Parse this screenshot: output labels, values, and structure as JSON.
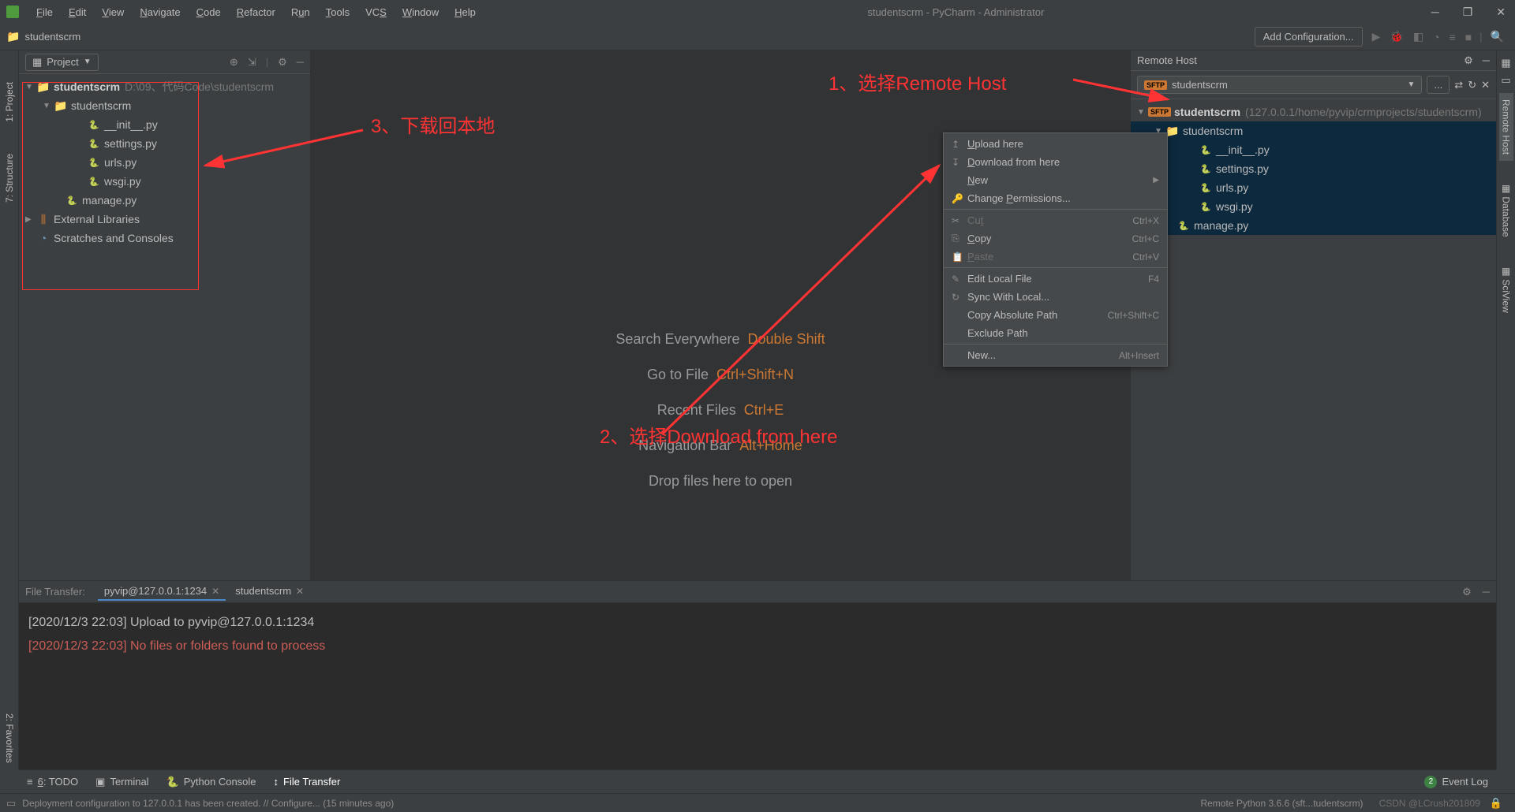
{
  "window": {
    "title": "studentscrm - PyCharm - Administrator"
  },
  "menu": {
    "file": "File",
    "edit": "Edit",
    "view": "View",
    "navigate": "Navigate",
    "code": "Code",
    "refactor": "Refactor",
    "run": "Run",
    "tools": "Tools",
    "vcs": "VCS",
    "window": "Window",
    "help": "Help"
  },
  "breadcrumb": {
    "project": "studentscrm"
  },
  "navbar": {
    "add_config": "Add Configuration..."
  },
  "left_gutter": {
    "project": "1: Project",
    "structure": "7: Structure"
  },
  "project_panel": {
    "selector": "Project",
    "root": "studentscrm",
    "root_path": "D:\\09、代码Code\\studentscrm",
    "folder1": "studentscrm",
    "files": [
      "__init__.py",
      "settings.py",
      "urls.py",
      "wsgi.py"
    ],
    "manage": "manage.py",
    "ext_lib": "External Libraries",
    "scratches": "Scratches and Consoles"
  },
  "editor_hints": {
    "search": "Search Everywhere",
    "search_sc": "Double Shift",
    "goto": "Go to File",
    "goto_sc": "Ctrl+Shift+N",
    "recent": "Recent Files",
    "recent_sc": "Ctrl+E",
    "nav": "Navigation Bar",
    "nav_sc": "Alt+Home",
    "drop": "Drop files here to open"
  },
  "remote_panel": {
    "title": "Remote Host",
    "selected": "studentscrm",
    "root": "studentscrm",
    "root_info": "(127.0.0.1/home/pyvip/crmprojects/studentscrm)",
    "folder1": "studentscrm",
    "files": [
      "__init__.py",
      "settings.py",
      "urls.py",
      "wsgi.py"
    ],
    "manage": "manage.py",
    "dots": "..."
  },
  "right_gutter": {
    "remote": "Remote Host",
    "database": "Database",
    "sciview": "SciView"
  },
  "context_menu": {
    "upload": "Upload here",
    "download": "Download from here",
    "new": "New",
    "change_perm": "Change Permissions...",
    "cut": "Cut",
    "cut_sc": "Ctrl+X",
    "copy": "Copy",
    "copy_sc": "Ctrl+C",
    "paste": "Paste",
    "paste_sc": "Ctrl+V",
    "edit_local": "Edit Local File",
    "edit_local_sc": "F4",
    "sync": "Sync With Local...",
    "copy_path": "Copy Absolute Path",
    "copy_path_sc": "Ctrl+Shift+C",
    "exclude": "Exclude Path",
    "new2": "New...",
    "new2_sc": "Alt+Insert"
  },
  "bottom_panel": {
    "label": "File Transfer:",
    "tab1": "pyvip@127.0.0.1:1234",
    "tab2": "studentscrm",
    "log1": "[2020/12/3 22:03] Upload to pyvip@127.0.0.1:1234",
    "log2": "[2020/12/3 22:03] No files or folders found to process"
  },
  "toolbar": {
    "todo": "6: TODO",
    "terminal": "Terminal",
    "python_console": "Python Console",
    "file_transfer": "File Transfer",
    "event_log": "Event Log",
    "badge": "2"
  },
  "statusbar": {
    "message": "Deployment configuration to 127.0.0.1 has been created. // Configure... (15 minutes ago)",
    "interpreter": "Remote Python 3.6.6 (sft...tudentscrm)",
    "watermark": "CSDN @LCrush201809"
  },
  "favorites": "2: Favorites",
  "annotations": {
    "a1": "1、选择Remote Host",
    "a2": "2、选择Download from here",
    "a3": "3、下载回本地"
  }
}
